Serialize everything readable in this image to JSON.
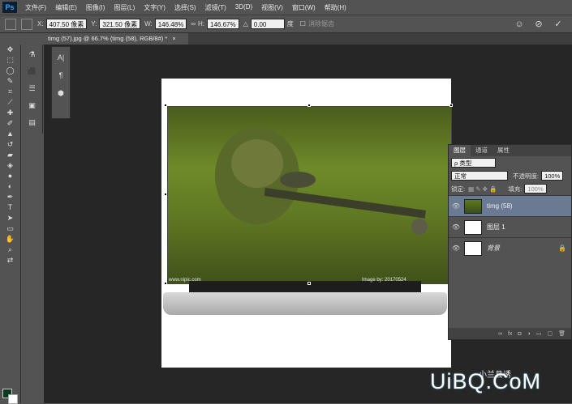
{
  "app": {
    "logo": "Ps"
  },
  "menu": [
    "文件(F)",
    "编辑(E)",
    "图像(I)",
    "图层(L)",
    "文字(Y)",
    "选择(S)",
    "滤镜(T)",
    "3D(D)",
    "视图(V)",
    "窗口(W)",
    "帮助(H)"
  ],
  "options": {
    "x_label": "X:",
    "x_value": "407.50 像素",
    "y_label": "Y:",
    "y_value": "321.50 像素",
    "w_label": "W:",
    "w_value": "146.48%",
    "h_label": "H:",
    "h_value": "146.67%",
    "angle_value": "0.00",
    "angle_unit": "度",
    "interp_label": "消除锯齿"
  },
  "document_tab": {
    "title": "timg (57).jpg @ 66.7% (timg (58), RGB/8#) *",
    "close": "×"
  },
  "photo_watermark_left": "www.nipic.com",
  "photo_watermark_right": "Image by: 20170524",
  "layers_panel": {
    "tabs": [
      "图层",
      "通道",
      "属性"
    ],
    "filter_label": "ρ 类型",
    "blend_mode": "正常",
    "opacity_label": "不透明度:",
    "opacity_value": "100%",
    "lock_label": "锁定:",
    "fill_label": "填充:",
    "fill_value": "100%",
    "layers": [
      {
        "name": "timg (58)",
        "selected": true,
        "thumb": "image"
      },
      {
        "name": "图层 1",
        "selected": false,
        "thumb": "laptop"
      },
      {
        "name": "背景",
        "selected": false,
        "thumb": "white",
        "locked": true
      }
    ]
  },
  "watermark": {
    "brand": "UiBQ.CoM",
    "wechat": "小兰县诱"
  },
  "colors": {
    "foreground": "#0b3a1e",
    "background": "#ffffff",
    "selected_layer": "#6a7a92"
  }
}
